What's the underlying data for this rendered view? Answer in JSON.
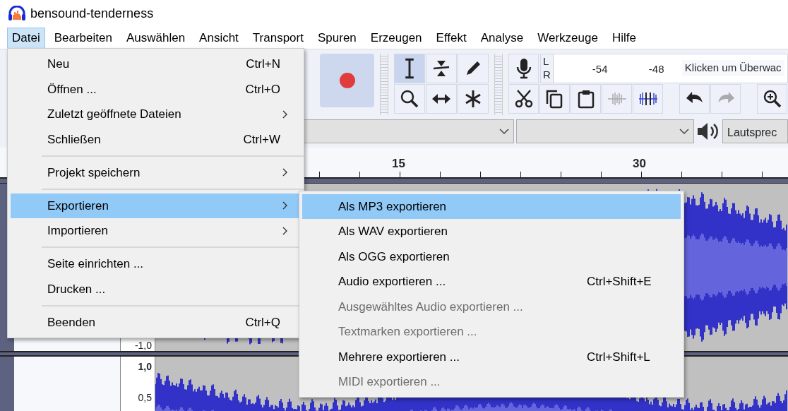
{
  "window": {
    "title": "bensound-tenderness"
  },
  "menu_bar": [
    {
      "label": "Datei",
      "selected": true
    },
    {
      "label": "Bearbeiten",
      "selected": false
    },
    {
      "label": "Auswählen",
      "selected": false
    },
    {
      "label": "Ansicht",
      "selected": false
    },
    {
      "label": "Transport",
      "selected": false
    },
    {
      "label": "Spuren",
      "selected": false
    },
    {
      "label": "Erzeugen",
      "selected": false
    },
    {
      "label": "Effekt",
      "selected": false
    },
    {
      "label": "Analyse",
      "selected": false
    },
    {
      "label": "Werkzeuge",
      "selected": false
    },
    {
      "label": "Hilfe",
      "selected": false
    }
  ],
  "file_menu": [
    {
      "kind": "item",
      "label": "Neu",
      "shortcut": "Ctrl+N",
      "selected": false
    },
    {
      "kind": "item",
      "label": "Öffnen ...",
      "shortcut": "Ctrl+O",
      "selected": false
    },
    {
      "kind": "submenu",
      "label": "Zuletzt geöffnete Dateien",
      "selected": false
    },
    {
      "kind": "item",
      "label": "Schließen",
      "shortcut": "Ctrl+W",
      "selected": false
    },
    {
      "kind": "separator"
    },
    {
      "kind": "submenu",
      "label": "Projekt speichern",
      "selected": false
    },
    {
      "kind": "separator"
    },
    {
      "kind": "submenu",
      "label": "Exportieren",
      "selected": true
    },
    {
      "kind": "submenu",
      "label": "Importieren",
      "selected": false
    },
    {
      "kind": "separator"
    },
    {
      "kind": "item",
      "label": "Seite einrichten ...",
      "selected": false
    },
    {
      "kind": "item",
      "label": "Drucken ...",
      "selected": false
    },
    {
      "kind": "separator"
    },
    {
      "kind": "item",
      "label": "Beenden",
      "shortcut": "Ctrl+Q",
      "selected": false
    }
  ],
  "export_submenu": [
    {
      "label": "Als MP3 exportieren",
      "selected": true,
      "disabled": false
    },
    {
      "label": "Als WAV exportieren",
      "selected": false,
      "disabled": false
    },
    {
      "label": "Als OGG exportieren",
      "selected": false,
      "disabled": false
    },
    {
      "label": "Audio exportieren ...",
      "shortcut": "Ctrl+Shift+E",
      "selected": false,
      "disabled": false
    },
    {
      "label": "Ausgewähltes Audio exportieren ...",
      "selected": false,
      "disabled": true
    },
    {
      "label": "Textmarken exportieren ...",
      "selected": false,
      "disabled": true
    },
    {
      "label": "Mehrere exportieren ...",
      "shortcut": "Ctrl+Shift+L",
      "selected": false,
      "disabled": false
    },
    {
      "label": "MIDI exportieren ...",
      "selected": false,
      "disabled": true
    }
  ],
  "tools": [
    {
      "kind": "select",
      "selected": true
    },
    {
      "kind": "envelope",
      "selected": false
    },
    {
      "kind": "draw",
      "selected": false
    },
    {
      "kind": "zoom",
      "selected": false
    },
    {
      "kind": "timeshift",
      "selected": false
    },
    {
      "kind": "multi",
      "selected": false
    }
  ],
  "meter": {
    "channels": [
      "L",
      "R"
    ],
    "ticks": [
      "-54",
      "-48"
    ],
    "hint": "Klicken um Überwac"
  },
  "edit_tools": [
    {
      "kind": "cut",
      "disabled": false
    },
    {
      "kind": "copy",
      "disabled": false
    },
    {
      "kind": "paste",
      "disabled": false
    },
    {
      "kind": "trim",
      "disabled": true
    },
    {
      "kind": "silence",
      "disabled": false
    },
    {
      "kind": "undo",
      "disabled": false
    },
    {
      "kind": "redo",
      "disabled": true
    },
    {
      "kind": "zoomin",
      "disabled": false
    }
  ],
  "device_bar": {
    "output_device": "Lautsprec"
  },
  "ruler": {
    "labels": [
      "15",
      "30"
    ]
  },
  "tracks": [
    {
      "scale": [
        "-1,0"
      ]
    },
    {
      "scale": [
        "1,0",
        "0,5"
      ]
    }
  ]
}
